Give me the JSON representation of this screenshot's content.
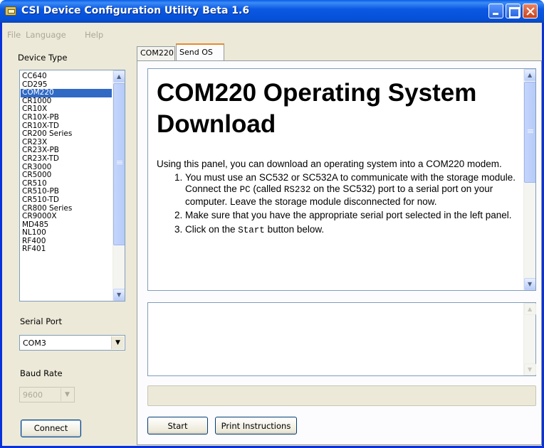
{
  "window": {
    "title": "CSI Device Configuration Utility Beta 1.6"
  },
  "menu": {
    "file": "File",
    "language": "Language",
    "help": "Help"
  },
  "left_panel": {
    "device_type_label": "Device Type",
    "devices": [
      "CC640",
      "CD295",
      "COM220",
      "CR1000",
      "CR10X",
      "CR10X-PB",
      "CR10X-TD",
      "CR200 Series",
      "CR23X",
      "CR23X-PB",
      "CR23X-TD",
      "CR3000",
      "CR5000",
      "CR510",
      "CR510-PB",
      "CR510-TD",
      "CR800 Series",
      "CR9000X",
      "MD485",
      "NL100",
      "RF400",
      "RF401"
    ],
    "selected_device": "COM220",
    "serial_port_label": "Serial Port",
    "serial_port_value": "COM3",
    "baud_rate_label": "Baud Rate",
    "baud_rate_value": "9600",
    "connect_label": "Connect"
  },
  "tabs": {
    "com220": "COM220",
    "send_os": "Send OS",
    "active": "Send OS"
  },
  "content": {
    "heading": "COM220 Operating System Download",
    "intro": "Using this panel, you can download an operating system into a COM220 modem.",
    "steps": {
      "s1_a": "You must use an SC532 or SC532A to communicate with the storage module. Connect the ",
      "s1_pc": "PC",
      "s1_b": " (called ",
      "s1_rs232": "RS232",
      "s1_c": " on the SC532) port to a serial port on your computer. Leave the storage module disconnected for now.",
      "s2": "Make sure that you have the appropriate serial port selected in the left panel.",
      "s3_a": "Click on the ",
      "s3_start": "Start",
      "s3_b": " button below."
    }
  },
  "buttons": {
    "start": "Start",
    "print": "Print Instructions"
  }
}
